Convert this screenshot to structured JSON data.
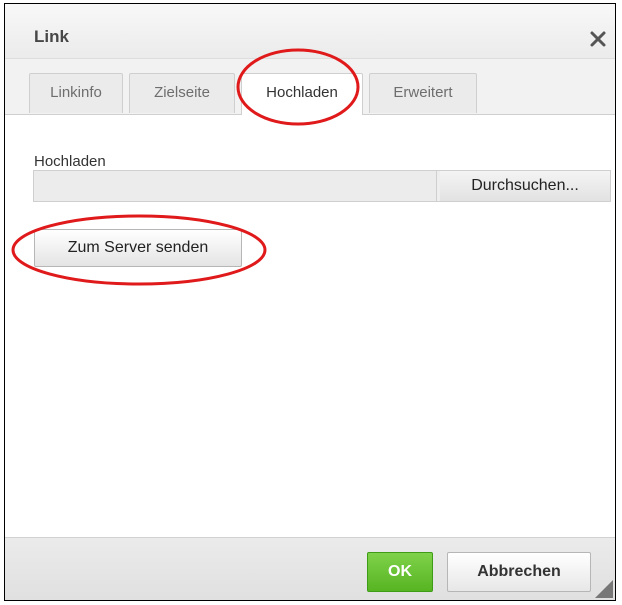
{
  "dialog": {
    "title": "Link",
    "close_icon": "close-icon"
  },
  "tabs": [
    {
      "label": "Linkinfo",
      "active": false
    },
    {
      "label": "Zielseite",
      "active": false
    },
    {
      "label": "Hochladen",
      "active": true
    },
    {
      "label": "Erweitert",
      "active": false
    }
  ],
  "upload": {
    "label": "Hochladen",
    "file_value": "",
    "browse_label": "Durchsuchen...",
    "send_label": "Zum Server senden"
  },
  "footer": {
    "ok_label": "OK",
    "cancel_label": "Abbrechen",
    "resize_icon": "resize-grip-icon"
  },
  "colors": {
    "ok_button": "#5cb82a",
    "annotation": "#e0191b"
  }
}
